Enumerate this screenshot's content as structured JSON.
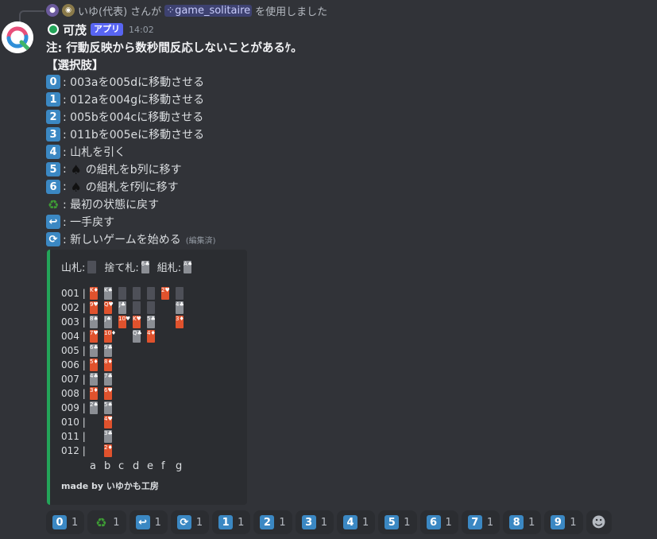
{
  "reply": {
    "user": "いゆ(代表)",
    "text_mid": "さんが",
    "command": "game_solitaire",
    "text_end": "を使用しました"
  },
  "author": {
    "name": "可茂",
    "badge": "アプリ",
    "time": "14:02"
  },
  "note": "注: 行動反映から数秒間反応しないことがあるｹ。",
  "choices_header": "【選択肢】",
  "options": [
    {
      "key": "0",
      "text": ": 003aを005dに移動させる"
    },
    {
      "key": "1",
      "text": ": 012aを004gに移動させる"
    },
    {
      "key": "2",
      "text": ": 005bを004cに移動させる"
    },
    {
      "key": "3",
      "text": ": 011bを005eに移動させる"
    },
    {
      "key": "4",
      "text": ": 山札を引く"
    },
    {
      "key": "5",
      "text": "の組札をb列に移す",
      "prefix": ": "
    },
    {
      "key": "6",
      "text": "の組札をf列に移す",
      "prefix": ": "
    }
  ],
  "extra_options": [
    {
      "icon": "recycle",
      "glyph": "♻",
      "text": ": 最初の状態に戻す"
    },
    {
      "icon": "undo",
      "glyph": "↩",
      "text": ": 一手戻す"
    },
    {
      "icon": "repeat",
      "glyph": "⟳",
      "text": ": 新しいゲームを始める"
    }
  ],
  "edited_label": "(編集済)",
  "embed": {
    "stock_label": "山札:",
    "waste_label": "捨て札:",
    "foundation_label": "組札:",
    "waste_card": "6♣",
    "foundation_card": "A♠",
    "rows": [
      "001 |",
      "002 |",
      "003 |",
      "004 |",
      "005 |",
      "006 |",
      "007 |",
      "008 |",
      "009 |",
      "010 |",
      "011 |",
      "012 |"
    ],
    "columns": [
      "a",
      "b",
      "c",
      "d",
      "e",
      "f",
      "g"
    ],
    "tableau": [
      [
        [
          "K♦",
          "r"
        ],
        [
          "9♥",
          "r"
        ],
        [
          "8♠",
          "b"
        ],
        [
          "7♥",
          "r"
        ],
        [
          "6♣",
          "b"
        ],
        [
          "5♦",
          "r"
        ],
        [
          "4♣",
          "b"
        ],
        [
          "3♦",
          "r"
        ],
        [
          "2♠",
          "b"
        ]
      ],
      [
        [
          "K♠",
          "b"
        ],
        [
          "Q♥",
          "r"
        ],
        [
          "J♠",
          "b"
        ],
        [
          "10♦",
          "r"
        ],
        [
          "9♣",
          "b"
        ],
        [
          "8♦",
          "r"
        ],
        [
          "7♣",
          "b"
        ],
        [
          "6♥",
          "r"
        ],
        [
          "5♠",
          "b"
        ],
        [
          "4♥",
          "r"
        ],
        [
          "3♣",
          "b"
        ],
        [
          "2♦",
          "r"
        ]
      ],
      [
        [
          "",
          "back"
        ],
        [
          "J♣",
          "b"
        ],
        [
          "10♥",
          "r"
        ]
      ],
      [
        [
          "",
          "back"
        ],
        [
          "",
          "back"
        ],
        [
          "K♥",
          "r"
        ],
        [
          "Q♣",
          "b"
        ]
      ],
      [
        [
          "",
          "back"
        ],
        [
          "",
          "back"
        ],
        [
          "5♣",
          "b"
        ],
        [
          "4♦",
          "r"
        ]
      ],
      [
        [
          "2♥",
          "r"
        ]
      ],
      [
        [
          "",
          "back"
        ],
        [
          "4♣",
          "b"
        ],
        [
          "3♦",
          "r"
        ]
      ]
    ],
    "made_by": "made by いゆかも工房"
  },
  "reactions": [
    {
      "icon": "keycap",
      "label": "0",
      "count": "1"
    },
    {
      "icon": "recycle",
      "label": "♻",
      "count": "1"
    },
    {
      "icon": "undo",
      "label": "↩",
      "count": "1"
    },
    {
      "icon": "repeat",
      "label": "⟳",
      "count": "1"
    },
    {
      "icon": "keycap",
      "label": "1",
      "count": "1"
    },
    {
      "icon": "keycap",
      "label": "2",
      "count": "1"
    },
    {
      "icon": "keycap",
      "label": "3",
      "count": "1"
    },
    {
      "icon": "keycap",
      "label": "4",
      "count": "1"
    },
    {
      "icon": "keycap",
      "label": "5",
      "count": "1"
    },
    {
      "icon": "keycap",
      "label": "6",
      "count": "1"
    },
    {
      "icon": "keycap",
      "label": "7",
      "count": "1"
    },
    {
      "icon": "keycap",
      "label": "8",
      "count": "1"
    },
    {
      "icon": "keycap",
      "label": "9",
      "count": "1"
    }
  ]
}
